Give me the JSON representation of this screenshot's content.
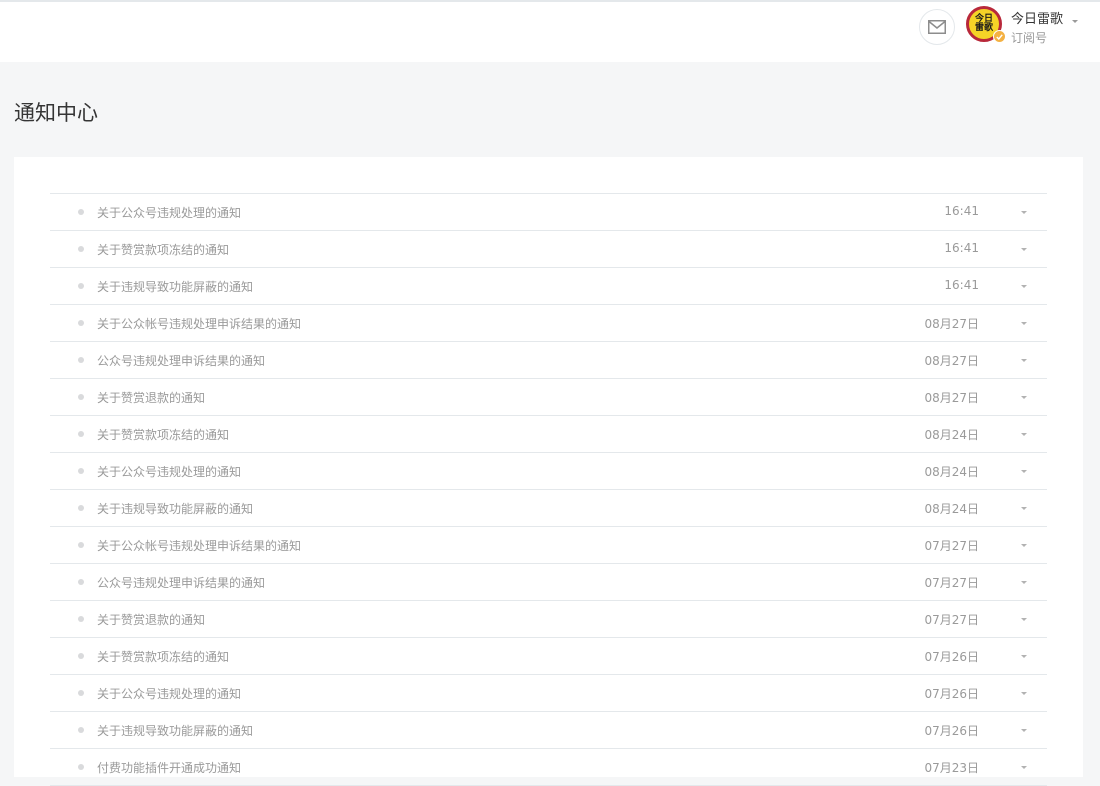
{
  "header": {
    "mail_icon": "envelope-icon",
    "account": {
      "avatar_text": "今日雷歌",
      "name": "今日雷歌",
      "type": "订阅号",
      "verified_icon": "check-badge-icon"
    }
  },
  "page": {
    "title": "通知中心"
  },
  "notifications": [
    {
      "title": "关于公众号违规处理的通知",
      "time": "16:41"
    },
    {
      "title": "关于赞赏款项冻结的通知",
      "time": "16:41"
    },
    {
      "title": "关于违规导致功能屏蔽的通知",
      "time": "16:41"
    },
    {
      "title": "关于公众帐号违规处理申诉结果的通知",
      "time": "08月27日"
    },
    {
      "title": "公众号违规处理申诉结果的通知",
      "time": "08月27日"
    },
    {
      "title": "关于赞赏退款的通知",
      "time": "08月27日"
    },
    {
      "title": "关于赞赏款项冻结的通知",
      "time": "08月24日"
    },
    {
      "title": "关于公众号违规处理的通知",
      "time": "08月24日"
    },
    {
      "title": "关于违规导致功能屏蔽的通知",
      "time": "08月24日"
    },
    {
      "title": "关于公众帐号违规处理申诉结果的通知",
      "time": "07月27日"
    },
    {
      "title": "公众号违规处理申诉结果的通知",
      "time": "07月27日"
    },
    {
      "title": "关于赞赏退款的通知",
      "time": "07月27日"
    },
    {
      "title": "关于赞赏款项冻结的通知",
      "time": "07月26日"
    },
    {
      "title": "关于公众号违规处理的通知",
      "time": "07月26日"
    },
    {
      "title": "关于违规导致功能屏蔽的通知",
      "time": "07月26日"
    },
    {
      "title": "付费功能插件开通成功通知",
      "time": "07月23日"
    }
  ]
}
